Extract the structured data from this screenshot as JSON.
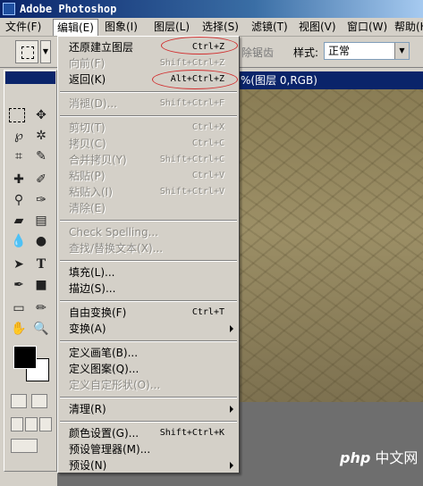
{
  "window": {
    "title": "Adobe Photoshop"
  },
  "menubar": {
    "items": [
      {
        "label": "文件(F)"
      },
      {
        "label": "编辑(E)"
      },
      {
        "label": "图象(I)"
      },
      {
        "label": "图层(L)"
      },
      {
        "label": "选择(S)"
      },
      {
        "label": "滤镜(T)"
      },
      {
        "label": "视图(V)"
      },
      {
        "label": "窗口(W)"
      },
      {
        "label": "帮助(H)"
      }
    ]
  },
  "options": {
    "antialias_label": "除锯齿",
    "style_label": "样式:",
    "style_value": "正常"
  },
  "document": {
    "title_fragment": "%(图层 0,RGB)"
  },
  "edit_menu": {
    "items": [
      {
        "label": "还原建立图层",
        "shortcut": "Ctrl+Z"
      },
      {
        "label": "向前(F)",
        "shortcut": "Shift+Ctrl+Z"
      },
      {
        "label": "返回(K)",
        "shortcut": "Alt+Ctrl+Z"
      },
      {
        "label": "消褪(D)...",
        "shortcut": "Shift+Ctrl+F"
      },
      {
        "label": "剪切(T)",
        "shortcut": "Ctrl+X"
      },
      {
        "label": "拷贝(C)",
        "shortcut": "Ctrl+C"
      },
      {
        "label": "合并拷贝(Y)",
        "shortcut": "Shift+Ctrl+C"
      },
      {
        "label": "粘贴(P)",
        "shortcut": "Ctrl+V"
      },
      {
        "label": "粘贴入(I)",
        "shortcut": "Shift+Ctrl+V"
      },
      {
        "label": "清除(E)",
        "shortcut": ""
      },
      {
        "label": "Check Spelling...",
        "shortcut": ""
      },
      {
        "label": "查找/替换文本(X)...",
        "shortcut": ""
      },
      {
        "label": "填充(L)...",
        "shortcut": ""
      },
      {
        "label": "描边(S)...",
        "shortcut": ""
      },
      {
        "label": "自由变换(F)",
        "shortcut": "Ctrl+T"
      },
      {
        "label": "变换(A)",
        "shortcut": ""
      },
      {
        "label": "定义画笔(B)...",
        "shortcut": ""
      },
      {
        "label": "定义图案(Q)...",
        "shortcut": ""
      },
      {
        "label": "定义自定形状(O)...",
        "shortcut": ""
      },
      {
        "label": "清理(R)",
        "shortcut": ""
      },
      {
        "label": "颜色设置(G)...",
        "shortcut": "Shift+Ctrl+K"
      },
      {
        "label": "预设管理器(M)...",
        "shortcut": ""
      },
      {
        "label": "预设(N)",
        "shortcut": ""
      }
    ]
  },
  "watermark": {
    "logo": "php",
    "text": "中文网"
  }
}
